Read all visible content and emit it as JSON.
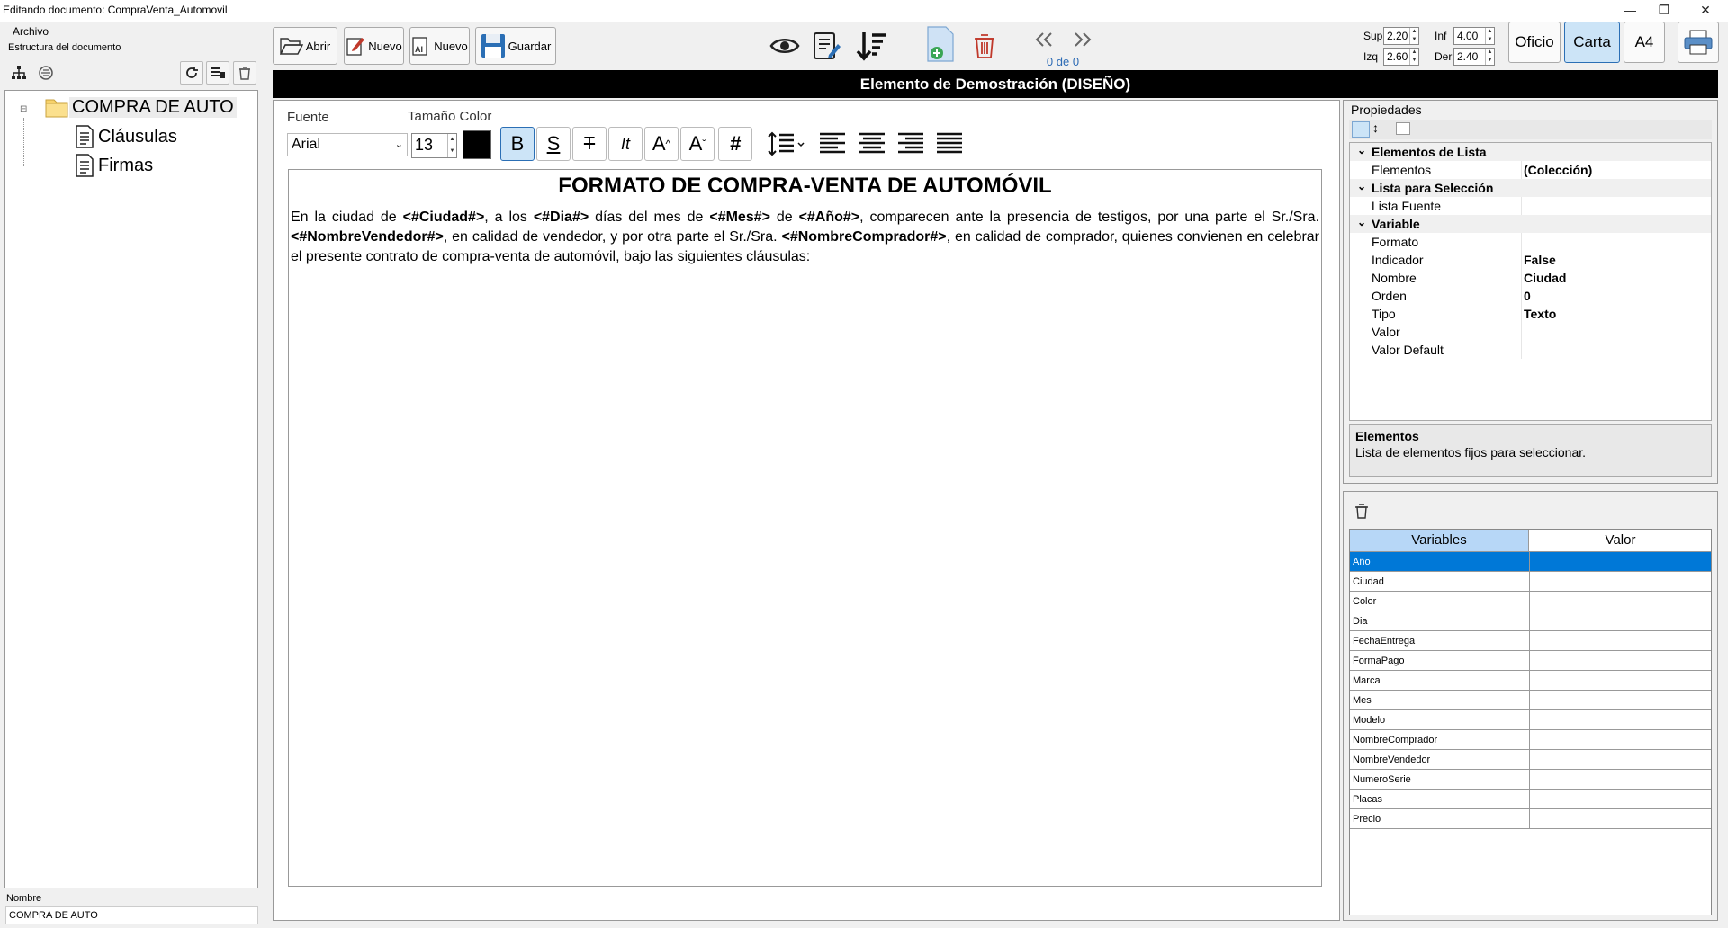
{
  "window": {
    "title": "Editando documento: CompraVenta_Automovil"
  },
  "menu": {
    "file": "Archivo"
  },
  "left": {
    "section_label": "Estructura del documento",
    "tree": {
      "root": "COMPRA DE AUTO",
      "children": [
        "Cláusulas",
        "Firmas"
      ]
    },
    "name_label": "Nombre",
    "name_value": "COMPRA DE AUTO"
  },
  "toolbar": {
    "open": "Abrir",
    "new": "Nuevo",
    "new_ai": "Nuevo",
    "save": "Guardar",
    "page_counter": "0 de 0",
    "margins": {
      "sup_label": "Sup",
      "sup": "2.20",
      "inf_label": "Inf",
      "inf": "4.00",
      "izq_label": "Izq",
      "izq": "2.60",
      "der_label": "Der",
      "der": "2.40"
    },
    "page_sizes": [
      "Oficio",
      "Carta",
      "A4"
    ],
    "selected_page_size": "Carta"
  },
  "design_bar": "Elemento de Demostración (DISEÑO)",
  "format": {
    "font_label": "Fuente",
    "size_color_label": "Tamaño Color",
    "font": "Arial",
    "size": "13",
    "bold": "B",
    "underline": "S",
    "strike": "T",
    "italic": "It",
    "grow": "A",
    "shrink": "A",
    "hash": "#"
  },
  "document": {
    "title": "FORMATO DE COMPRA-VENTA DE AUTOMÓVIL",
    "p1": "En la ciudad de ",
    "v_ciudad": "<#Ciudad#>",
    "p2": ", a los ",
    "v_dia": "<#Dia#>",
    "p3": " días del mes de ",
    "v_mes": "<#Mes#>",
    "p4": " de ",
    "v_anio": "<#Año#>",
    "p5": ", comparecen ante la presencia de testigos, por una parte el Sr./Sra. ",
    "v_vendedor": "<#NombreVendedor#>",
    "p6": ", en calidad de vendedor, y por otra parte el Sr./Sra. ",
    "v_comprador": "<#NombreComprador#>",
    "p7": ", en calidad de comprador, quienes convienen en celebrar el presente contrato de compra-venta de automóvil, bajo las siguientes cláusulas:"
  },
  "properties": {
    "label": "Propiedades",
    "rows": [
      {
        "kind": "cat",
        "k": "Elementos de Lista"
      },
      {
        "k": "Elementos",
        "v": "(Colección)"
      },
      {
        "kind": "cat",
        "k": "Lista para Selección"
      },
      {
        "k": "Lista Fuente",
        "v": ""
      },
      {
        "kind": "cat",
        "k": "Variable"
      },
      {
        "k": "Formato",
        "v": ""
      },
      {
        "k": "Indicador",
        "v": "False"
      },
      {
        "k": "Nombre",
        "v": "Ciudad"
      },
      {
        "k": "Orden",
        "v": "0"
      },
      {
        "k": "Tipo",
        "v": "Texto"
      },
      {
        "k": "Valor",
        "v": ""
      },
      {
        "k": "Valor Default",
        "v": ""
      }
    ],
    "desc_title": "Elementos",
    "desc_text": "Lista de elementos fijos para seleccionar."
  },
  "variables": {
    "col_name": "Variables",
    "col_value": "Valor",
    "rows": [
      "Año",
      "Ciudad",
      "Color",
      "Dia",
      "FechaEntrega",
      "FormaPago",
      "Marca",
      "Mes",
      "Modelo",
      "NombreComprador",
      "NombreVendedor",
      "NumeroSerie",
      "Placas",
      "Precio"
    ],
    "selected": "Año"
  },
  "colors": {
    "selection": "#0078d7",
    "header_blue": "#b7d7f7",
    "design_bar": "#000000",
    "page_counter": "#2d6bb5"
  }
}
